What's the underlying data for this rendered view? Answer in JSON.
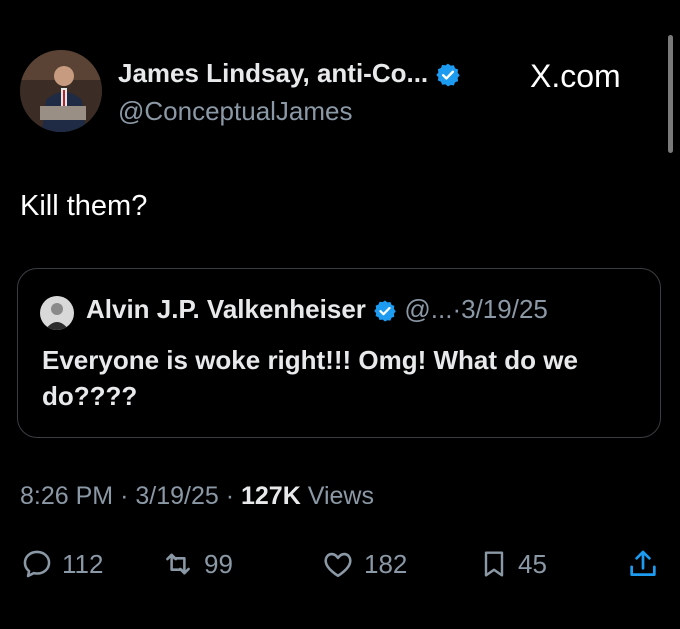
{
  "tweet": {
    "author_name": "James Lindsay, anti-Co...",
    "author_handle": "@ConceptualJames",
    "brand_watermark": "X.com",
    "text": "Kill them?",
    "time": "8:26 PM",
    "date": "3/19/25",
    "views_count": "127K",
    "views_label": "Views"
  },
  "quoted_tweet": {
    "author_name": "Alvin J.P. Valkenheiser",
    "handle": "@...",
    "date": "3/19/25",
    "text": "Everyone is woke right!!! Omg! What do we do????"
  },
  "actions": {
    "replies": "112",
    "reposts": "99",
    "likes": "182",
    "bookmarks": "45"
  },
  "colors": {
    "background": "#000000",
    "text_primary": "#e7e9ea",
    "text_secondary": "#8b98a5",
    "verified_blue": "#1d9bf0",
    "border": "#3a3d41"
  },
  "icons": [
    "verified-badge-icon",
    "reply-icon",
    "repost-icon",
    "like-icon",
    "bookmark-icon",
    "share-icon"
  ]
}
